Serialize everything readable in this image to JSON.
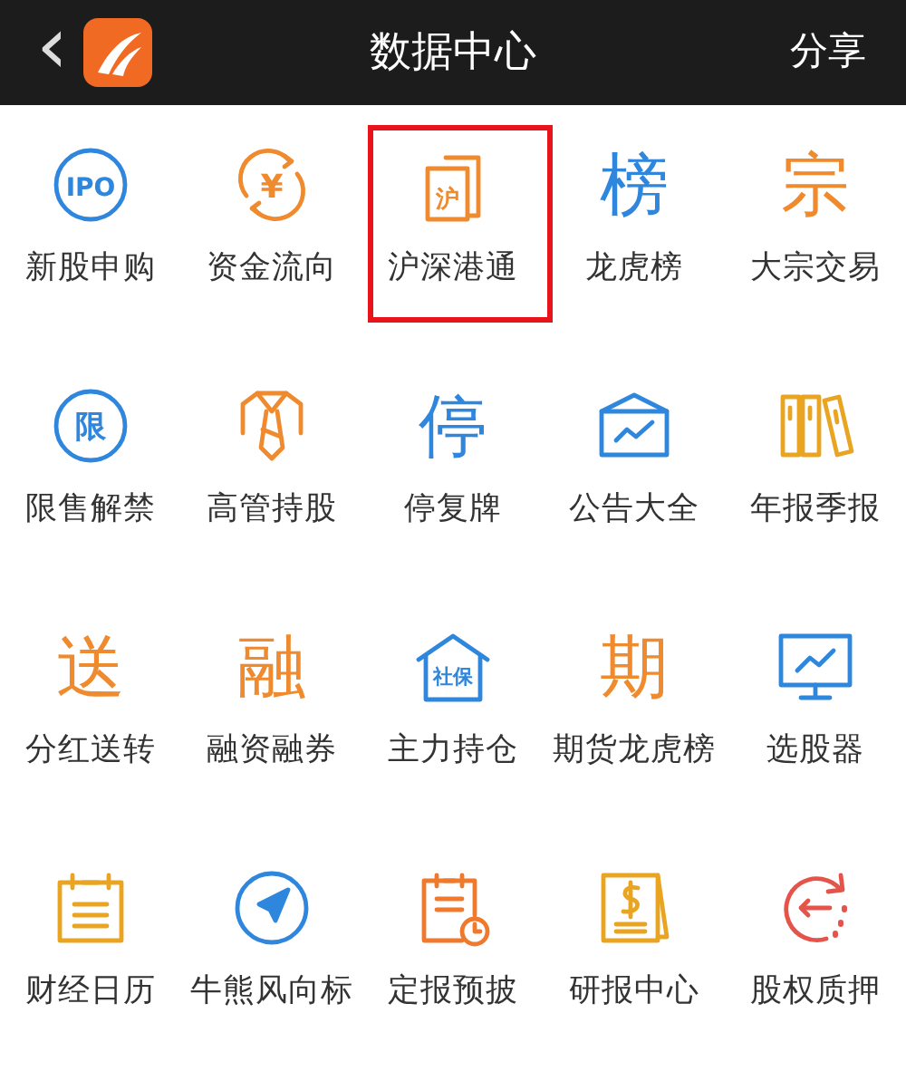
{
  "header": {
    "back": "‹",
    "title": "数据中心",
    "share": "分享"
  },
  "items": [
    {
      "label": "新股申购",
      "highlighted": false,
      "icon": {
        "kind": "circle",
        "glyph": "IPO",
        "color": "#2f86dd"
      }
    },
    {
      "label": "资金流向",
      "highlighted": false,
      "icon": {
        "kind": "yen",
        "glyph": "¥",
        "color": "#ef8a2e"
      }
    },
    {
      "label": "沪深港通",
      "highlighted": true,
      "icon": {
        "kind": "doc",
        "glyph": "沪",
        "color": "#ef8a2e"
      }
    },
    {
      "label": "龙虎榜",
      "highlighted": false,
      "icon": {
        "kind": "char",
        "glyph": "榜",
        "color": "#2f86dd"
      }
    },
    {
      "label": "大宗交易",
      "highlighted": false,
      "icon": {
        "kind": "char",
        "glyph": "宗",
        "color": "#ef8a2e"
      }
    },
    {
      "label": "限售解禁",
      "highlighted": false,
      "icon": {
        "kind": "circle",
        "glyph": "限",
        "color": "#2f86dd"
      }
    },
    {
      "label": "高管持股",
      "highlighted": false,
      "icon": {
        "kind": "tie",
        "color": "#ef8a2e"
      }
    },
    {
      "label": "停复牌",
      "highlighted": false,
      "icon": {
        "kind": "char",
        "glyph": "停",
        "color": "#2f86dd"
      }
    },
    {
      "label": "公告大全",
      "highlighted": false,
      "icon": {
        "kind": "board",
        "color": "#2f86dd"
      }
    },
    {
      "label": "年报季报",
      "highlighted": false,
      "icon": {
        "kind": "folders",
        "color": "#e9a521"
      }
    },
    {
      "label": "分红送转",
      "highlighted": false,
      "icon": {
        "kind": "char",
        "glyph": "送",
        "color": "#ef8a2e"
      }
    },
    {
      "label": "融资融券",
      "highlighted": false,
      "icon": {
        "kind": "char",
        "glyph": "融",
        "color": "#ef8a2e"
      }
    },
    {
      "label": "主力持仓",
      "highlighted": false,
      "icon": {
        "kind": "house",
        "glyph": "社保",
        "color": "#2f86dd"
      }
    },
    {
      "label": "期货龙虎榜",
      "highlighted": false,
      "icon": {
        "kind": "char",
        "glyph": "期",
        "color": "#ef8a2e"
      }
    },
    {
      "label": "选股器",
      "highlighted": false,
      "icon": {
        "kind": "monitor",
        "color": "#2f86dd"
      }
    },
    {
      "label": "财经日历",
      "highlighted": false,
      "icon": {
        "kind": "calendar",
        "color": "#e9a521"
      }
    },
    {
      "label": "牛熊风向标",
      "highlighted": false,
      "icon": {
        "kind": "compass",
        "color": "#2f86dd"
      }
    },
    {
      "label": "定报预披",
      "highlighted": false,
      "icon": {
        "kind": "memo-clock",
        "color": "#ef7a2e"
      }
    },
    {
      "label": "研报中心",
      "highlighted": false,
      "icon": {
        "kind": "dollar-doc",
        "color": "#e9a521"
      }
    },
    {
      "label": "股权质押",
      "highlighted": false,
      "icon": {
        "kind": "pledge",
        "color": "#e5544a"
      }
    }
  ]
}
